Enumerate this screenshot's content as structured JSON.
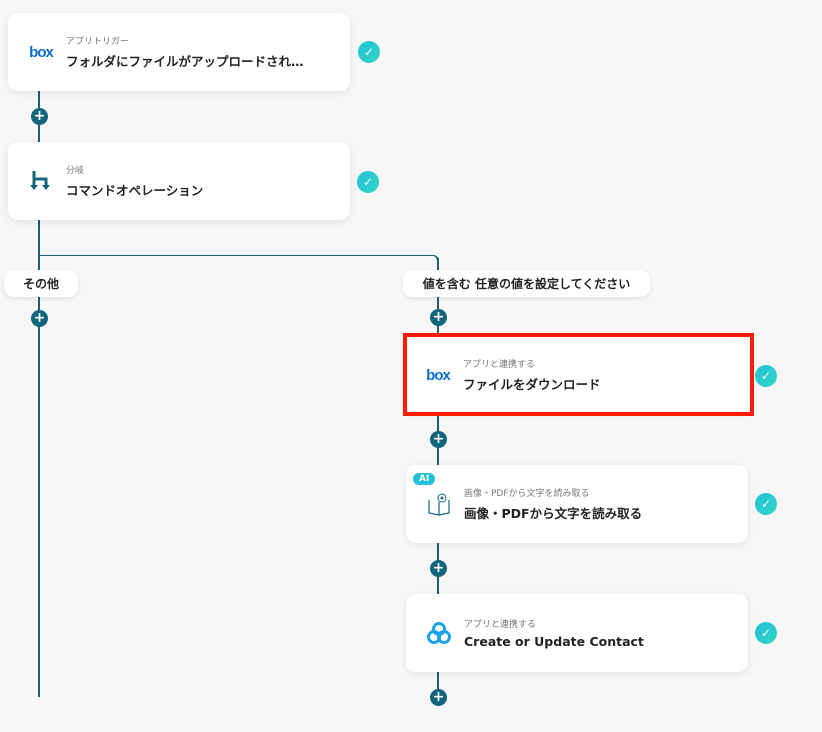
{
  "nodes": [
    {
      "sub": "アプリトリガー",
      "title": "フォルダにファイルがアップロードされ…",
      "icon": "box-logo"
    },
    {
      "sub": "分岐",
      "title": "コマンドオペレーション",
      "icon": "branch-icon"
    },
    {
      "sub": "アプリと連携する",
      "title": "ファイルをダウンロード",
      "icon": "box-logo"
    },
    {
      "sub": "画像・PDFから文字を読み取る",
      "title": "画像・PDFから文字を読み取る",
      "icon": "book-eye-icon",
      "badge": "AI"
    },
    {
      "sub": "アプリと連携する",
      "title": "Create or Update Contact",
      "icon": "triple-circle-icon"
    }
  ],
  "branches": {
    "left": "その他",
    "right": "値を含む 任意の値を設定してください"
  },
  "box_logo": "box",
  "colors": {
    "accent": "#13657c",
    "check": "#22c1d6",
    "highlight": "#ff1a00"
  }
}
